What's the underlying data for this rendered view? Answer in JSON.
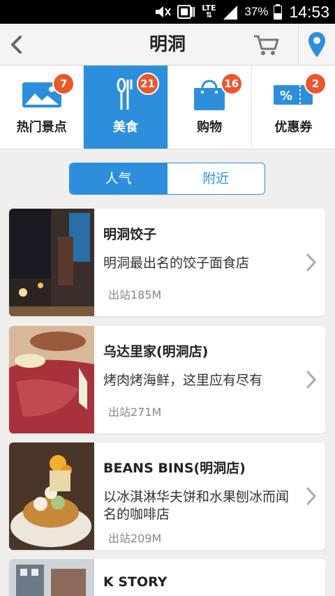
{
  "status_bar": {
    "network": "LTE",
    "battery": "37%",
    "time": "14:53",
    "icons": [
      "mute-icon",
      "nfc-icon",
      "lte-icon",
      "signal-icon",
      "battery-icon"
    ]
  },
  "header": {
    "title": "明洞",
    "back_icon": "back-chevron-icon",
    "cart_icon": "cart-icon",
    "location_icon": "location-pin-icon"
  },
  "categories": [
    {
      "label": "热门景点",
      "badge": "7",
      "icon": "landscape-icon",
      "active": false
    },
    {
      "label": "美食",
      "badge": "21",
      "icon": "utensils-icon",
      "active": true
    },
    {
      "label": "购物",
      "badge": "16",
      "icon": "shopping-bag-icon",
      "active": false
    },
    {
      "label": "优惠券",
      "badge": "2",
      "icon": "coupon-icon",
      "active": false
    }
  ],
  "tabs": {
    "popular": "人气",
    "nearby": "附近",
    "selected": "popular"
  },
  "places": [
    {
      "name": "明洞饺子",
      "desc": "明洞最出名的饺子面食店",
      "distance": "出站185M"
    },
    {
      "name": "乌达里家(明洞店)",
      "desc": "烤肉烤海鲜，这里应有尽有",
      "distance": "出站271M"
    },
    {
      "name": "BEANS BINS(明洞店)",
      "desc": "以冰淇淋华夫饼和水果刨冰而闻名的咖啡店",
      "distance": "出站209M"
    },
    {
      "name": "K STORY",
      "desc": "",
      "distance": ""
    }
  ],
  "colors": {
    "accent": "#2d8fdc",
    "badge": "#e9582c",
    "background": "#f0efed"
  }
}
